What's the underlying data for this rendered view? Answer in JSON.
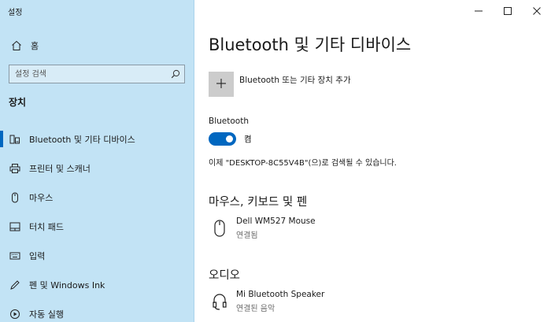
{
  "app": {
    "title": "설정"
  },
  "window_controls": {
    "minimize_icon": "minimize-icon",
    "maximize_icon": "maximize-icon",
    "close_icon": "close-icon"
  },
  "sidebar": {
    "home": {
      "label": "홈",
      "icon": "home-icon"
    },
    "search": {
      "placeholder": "설정 검색",
      "icon": "search-icon"
    },
    "section_label": "장치",
    "items": [
      {
        "label": "Bluetooth 및 기타 디바이스",
        "icon": "bluetooth-devices-icon",
        "active": true
      },
      {
        "label": "프린터 및 스캐너",
        "icon": "printer-icon"
      },
      {
        "label": "마우스",
        "icon": "mouse-icon"
      },
      {
        "label": "터치 패드",
        "icon": "touchpad-icon"
      },
      {
        "label": "입력",
        "icon": "keyboard-icon"
      },
      {
        "label": "펜 및 Windows Ink",
        "icon": "pen-icon"
      },
      {
        "label": "자동 실행",
        "icon": "autoplay-icon"
      }
    ]
  },
  "main": {
    "title": "Bluetooth 및 기타 디바이스",
    "add_device_label": "Bluetooth 또는 기타 장치 추가",
    "bluetooth_label": "Bluetooth",
    "toggle_state_label": "켬",
    "toggle_on": true,
    "discoverable_text": "이제 \"DESKTOP-8C55V4B\"(으)로 검색될 수 있습니다.",
    "sections": [
      {
        "heading": "마우스, 키보드 및 펜",
        "devices": [
          {
            "name": "Dell WM527 Mouse",
            "status": "연결됨",
            "icon": "mouse-icon"
          }
        ]
      },
      {
        "heading": "오디오",
        "devices": [
          {
            "name": "Mi Bluetooth Speaker",
            "status": "연결된 음악",
            "icon": "headset-icon"
          }
        ]
      }
    ]
  },
  "colors": {
    "sidebar_bg": "#c2e3f5",
    "accent": "#0067c0",
    "add_button_bg": "#cccccc"
  }
}
